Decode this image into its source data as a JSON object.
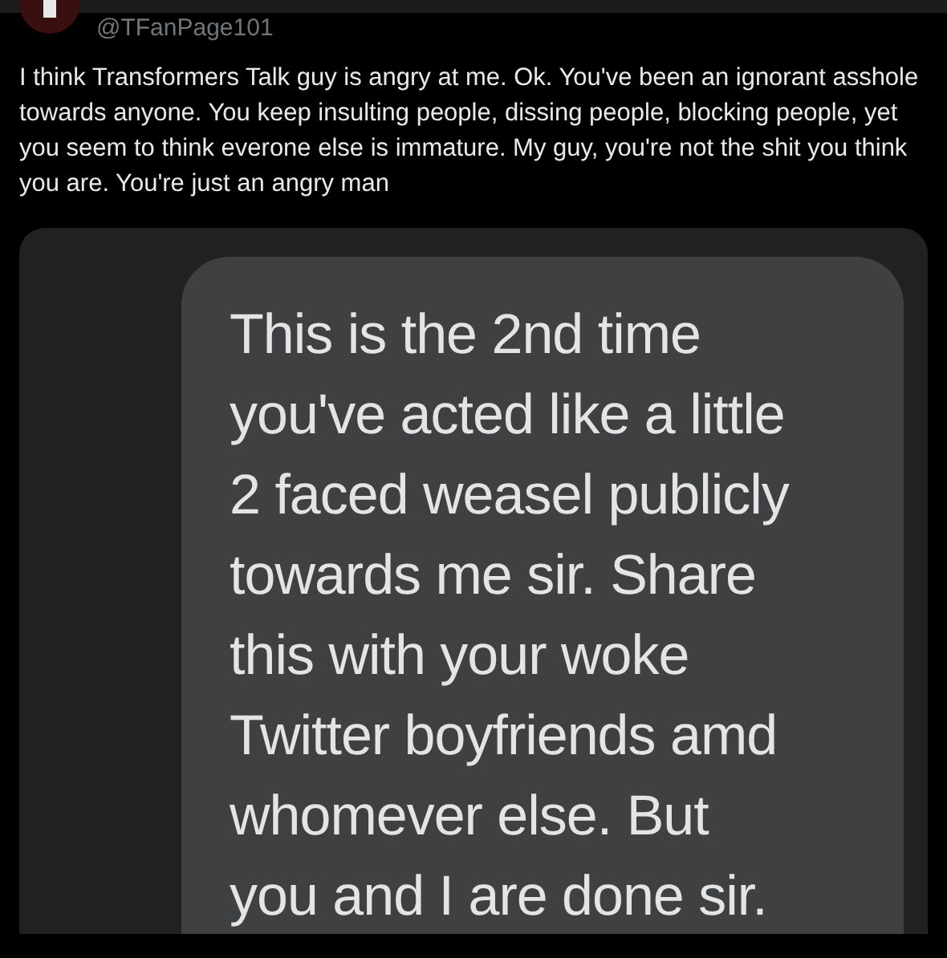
{
  "tweet": {
    "handle": "@TFanPage101",
    "text": "I think Transformers Talk guy is angry at me. Ok. You've been an ignorant asshole towards anyone. You keep insulting people, dissing people, blocking people, yet you seem to think everone else is immature. My guy, you're not the shit you think you are. You're just an angry man"
  },
  "attached_screenshot": {
    "message_lines": [
      "This is the 2nd time",
      "you've acted like a little",
      "2 faced weasel publicly",
      "towards me sir. Share",
      "this with your woke",
      "Twitter boyfriends amd",
      "whomever else. But",
      "you and I are done sir."
    ]
  }
}
